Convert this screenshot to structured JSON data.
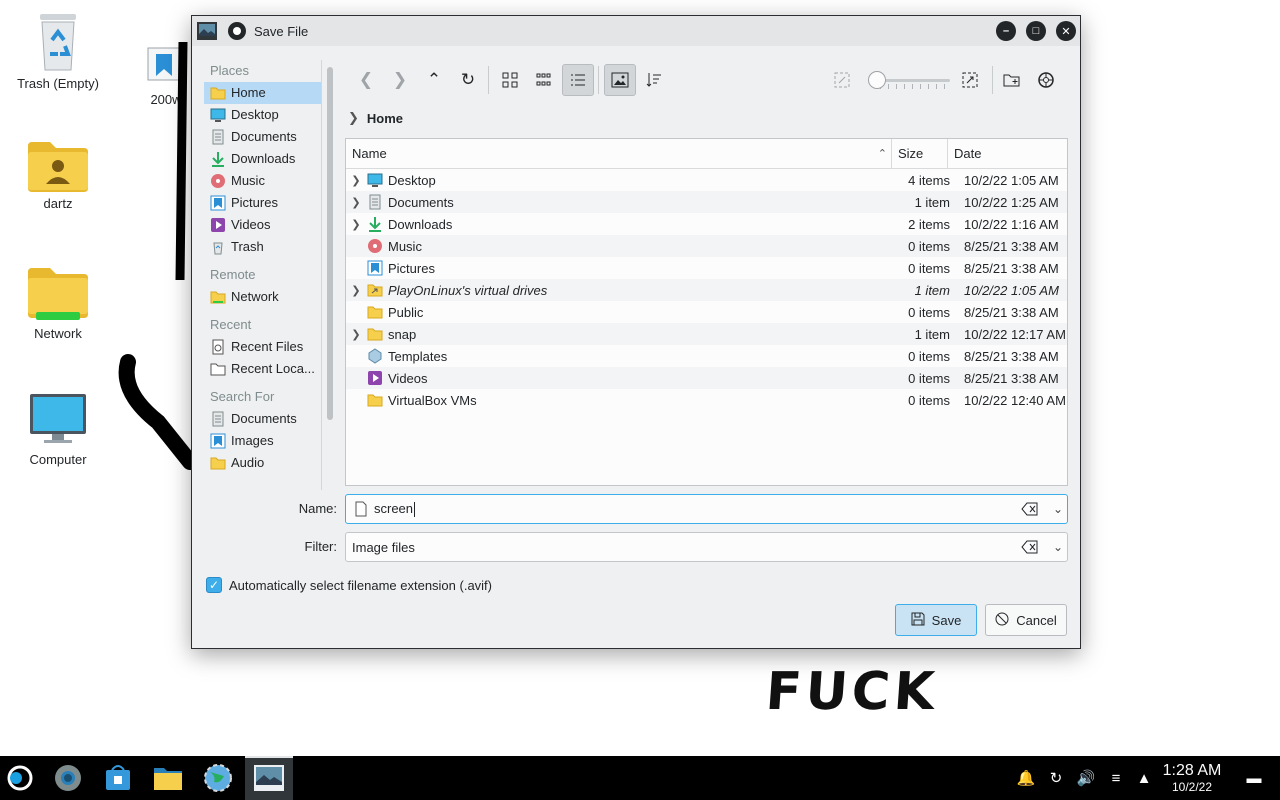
{
  "desktop": {
    "icons": [
      {
        "label": "Trash (Empty)"
      },
      {
        "label": "dartz"
      },
      {
        "label": "Network"
      },
      {
        "label": "Computer"
      }
    ],
    "partial_label": "200w",
    "scribble_text": "FUCK"
  },
  "dialog": {
    "title": "Save File",
    "places": {
      "sections": {
        "places": "Places",
        "remote": "Remote",
        "recent": "Recent",
        "search_for": "Search For"
      },
      "places_items": [
        "Home",
        "Desktop",
        "Documents",
        "Downloads",
        "Music",
        "Pictures",
        "Videos",
        "Trash"
      ],
      "remote_items": [
        "Network"
      ],
      "recent_items": [
        "Recent Files",
        "Recent Loca..."
      ],
      "search_items": [
        "Documents",
        "Images",
        "Audio"
      ],
      "selected": "Home"
    },
    "breadcrumb": {
      "current": "Home"
    },
    "table": {
      "headers": {
        "name": "Name",
        "size": "Size",
        "date": "Date"
      },
      "rows": [
        {
          "name": "Desktop",
          "size": "4 items",
          "date": "10/2/22 1:05 AM",
          "icon": "desktop-folder-icon",
          "expandable": true
        },
        {
          "name": "Documents",
          "size": "1 item",
          "date": "10/2/22 1:25 AM",
          "icon": "documents-folder-icon",
          "expandable": true
        },
        {
          "name": "Downloads",
          "size": "2 items",
          "date": "10/2/22 1:16 AM",
          "icon": "downloads-folder-icon",
          "expandable": true
        },
        {
          "name": "Music",
          "size": "0 items",
          "date": "8/25/21 3:38 AM",
          "icon": "music-folder-icon",
          "expandable": false
        },
        {
          "name": "Pictures",
          "size": "0 items",
          "date": "8/25/21 3:38 AM",
          "icon": "pictures-folder-icon",
          "expandable": false
        },
        {
          "name": "PlayOnLinux's virtual drives",
          "size": "1 item",
          "date": "10/2/22 1:05 AM",
          "icon": "symlink-folder-icon",
          "expandable": true
        },
        {
          "name": "Public",
          "size": "0 items",
          "date": "8/25/21 3:38 AM",
          "icon": "folder-icon",
          "expandable": false
        },
        {
          "name": "snap",
          "size": "1 item",
          "date": "10/2/22 12:17 AM",
          "icon": "folder-icon",
          "expandable": true
        },
        {
          "name": "Templates",
          "size": "0 items",
          "date": "8/25/21 3:38 AM",
          "icon": "templates-folder-icon",
          "expandable": false
        },
        {
          "name": "Videos",
          "size": "0 items",
          "date": "8/25/21 3:38 AM",
          "icon": "videos-folder-icon",
          "expandable": false
        },
        {
          "name": "VirtualBox VMs",
          "size": "0 items",
          "date": "10/2/22 12:40 AM",
          "icon": "folder-icon",
          "expandable": false
        }
      ]
    },
    "name_field": {
      "label": "Name:",
      "value": "screen"
    },
    "filter_field": {
      "label": "Filter:",
      "value": "Image files"
    },
    "auto_ext": {
      "label": "Automatically select filename extension (.avif)",
      "checked": true
    },
    "buttons": {
      "save": "Save",
      "cancel": "Cancel"
    }
  },
  "taskbar": {
    "clock_time": "1:28 AM",
    "clock_date": "10/2/22"
  },
  "colors": {
    "accent": "#3daee9",
    "selection": "#b6d9f5",
    "folder": "#f6d04d",
    "taskbar": "#000000"
  }
}
